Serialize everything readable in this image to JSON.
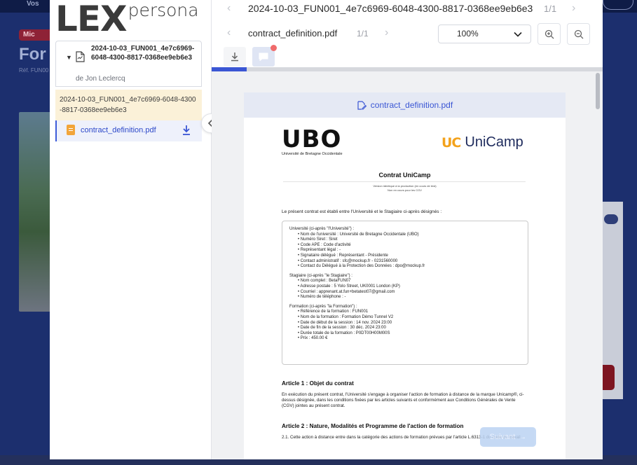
{
  "background": {
    "top_word": "Vos",
    "badge": "Mic",
    "title": "For",
    "ref": "Réf. FUN00"
  },
  "sidebar": {
    "logo": {
      "lex": "LEX",
      "persona": "persona"
    },
    "envelope": {
      "name": "2024-10-03_FUN001_4e7c6969-6048-4300-8817-0368ee9eb6e3",
      "author": "de Jon Leclercq"
    },
    "selected_envelope": "2024-10-03_FUN001_4e7c6969-6048-4300-8817-0368ee9eb6e3",
    "document": {
      "name": "contract_definition.pdf"
    }
  },
  "toolbar": {
    "envelope_title": "2024-10-03_FUN001_4e7c6969-6048-4300-8817-0368ee9eb6e3",
    "envelope_count": "1/1",
    "document_title": "contract_definition.pdf",
    "document_count": "1/1",
    "zoom": "100%",
    "progress_fraction": 0.09
  },
  "document": {
    "header": "contract_definition.pdf",
    "logos": {
      "ubo": "UBO",
      "ubo_sub": "Université de Bretagne Occidentale",
      "uc": "UC",
      "unicamp": "UniCamp"
    },
    "title": "Contrat UniCamp",
    "note_line1": "Version identique à la production (en cours de test)",
    "note_line2": "Non en cours pour les CGV",
    "intro": "Le présent contrat est établi entre l'Université et le Stagiaire ci-après désignés :",
    "universite": {
      "heading": "Université (ci-après \"l'Université\") :",
      "items": [
        "• Nom de l'université : Université de Bretagne Occidentale (UBO)",
        "• Numéro Siret : Siret",
        "• Code APE : Code d'activité",
        "• Représentant légal : -",
        "• Signataire délégué : Représentant - Présidente",
        "• Contact administratif : sfc@mockup.fr - 0231560000",
        "• Contact du Délégué à la Protection des Données : dpo@mockup.fr"
      ]
    },
    "stagiaire": {
      "heading": "Stagiaire (ci-après \"le Stagiaire\") :",
      "items": [
        "• Nom complet : BetaFUN07",
        "• Adresse postale : 5 Yolo Street, UK0001 London (KP)",
        "• Courriel : apprenant.at.fun+betatest07@gmail.com",
        "• Numéro de téléphone : -"
      ]
    },
    "formation": {
      "heading": "Formation (ci-après \"la Formation\") :",
      "items": [
        "• Référence de la formation : FUN001",
        "• Nom de la formation : Formation Démo Tunnel V2",
        "• Date de début de la session : 14 nov. 2024 23:00",
        "• Date de fin de la session : 30 déc. 2024 23:00",
        "• Durée totale de la formation : P0DT00H00M00S",
        "• Prix : 450.00 €"
      ]
    },
    "article1": {
      "title": "Article 1 : Objet du contrat",
      "text": "En exécution du présent contrat, l'Université s'engage à organiser l'action de formation à distance de la marque Unicamp®, ci-dessus désignée, dans les conditions fixées par les articles suivants et conformément aux Conditions Générales de Vente (CGV) jointes au présent contrat."
    },
    "article2": {
      "title": "Article 2 : Nature, Modalités et Programme de l'action de formation",
      "text": "2.1. Cette action à distance entre dans la catégorie des actions de formation prévues par l'article L.6313-1 du code du travail."
    }
  },
  "next_button": "Suivant"
}
